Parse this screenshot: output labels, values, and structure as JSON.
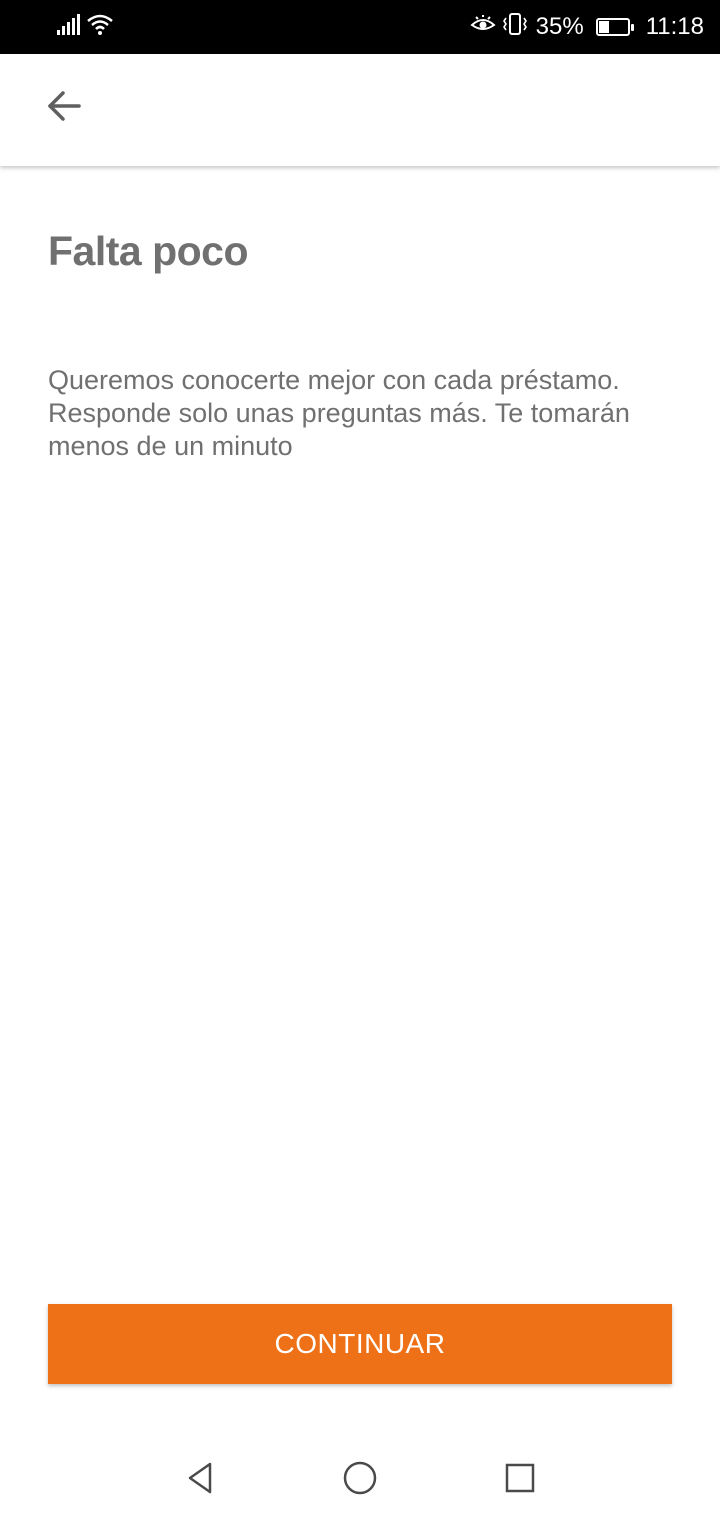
{
  "status_bar": {
    "battery_percent": "35%",
    "battery_level": 0.35,
    "time": "11:18",
    "icons": [
      "signal-icon",
      "wifi-icon",
      "eye-comfort-icon",
      "vibrate-icon",
      "battery-icon"
    ]
  },
  "app_bar": {
    "back_icon": "arrow-back-icon"
  },
  "content": {
    "title": "Falta poco",
    "subtitle": "Queremos conocerte mejor con cada préstamo. Responde solo unas preguntas más. Te tomarán menos de un minuto"
  },
  "actions": {
    "continue_label": "CONTINUAR",
    "continue_color": "#EE7117"
  },
  "nav_bar": {
    "icons": [
      "back-triangle-icon",
      "home-circle-icon",
      "recents-square-icon"
    ]
  },
  "colors": {
    "text_gray": "#707070",
    "icon_gray": "#5f5f5f",
    "status_bar_bg": "#000000"
  }
}
